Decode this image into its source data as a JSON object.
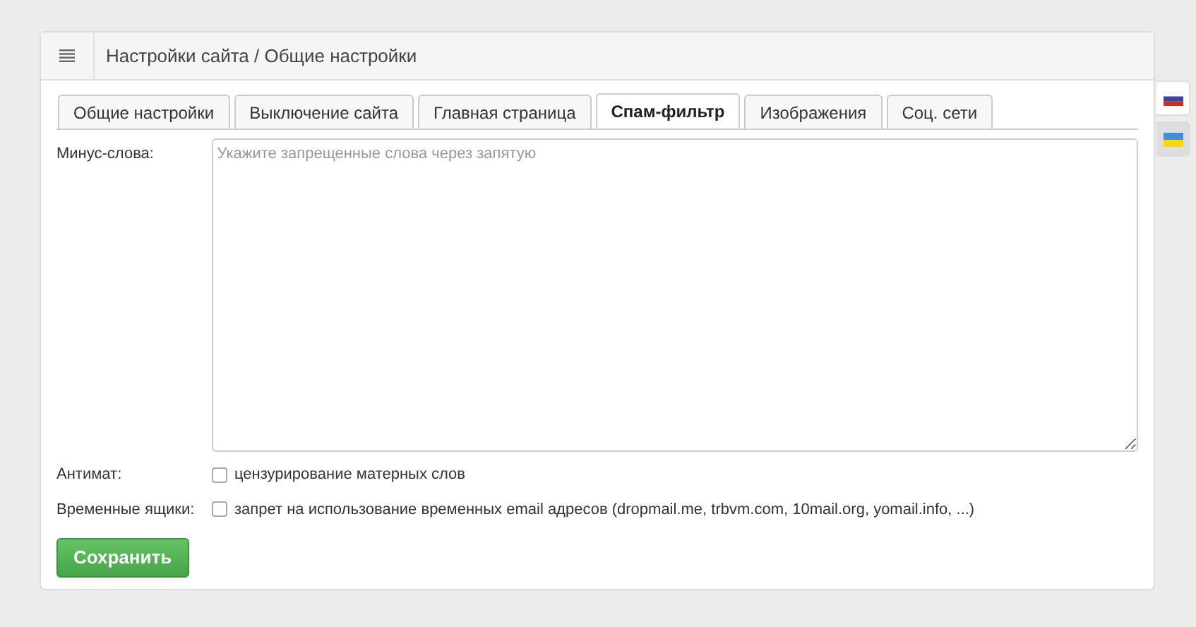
{
  "header": {
    "title": "Настройки сайта / Общие настройки"
  },
  "tabs": [
    {
      "label": "Общие настройки",
      "selected": false
    },
    {
      "label": "Выключение сайта",
      "selected": false
    },
    {
      "label": "Главная страница",
      "selected": false
    },
    {
      "label": "Спам-фильтр",
      "selected": true
    },
    {
      "label": "Изображения",
      "selected": false
    },
    {
      "label": "Соц. сети",
      "selected": false
    }
  ],
  "stop_words": {
    "label": "Минус-слова:",
    "placeholder": "Укажите запрещенные слова через запятую"
  },
  "options": [
    {
      "label": "Антимат:",
      "text": "цензурирование матерных слов",
      "checked": false
    },
    {
      "label": "Временные ящики:",
      "text": "запрет на использование временных email адресов (dropmail.me, trbvm.com, 10mail.org, yomail.info, ...)",
      "checked": false
    }
  ],
  "save_button": "Сохранить",
  "languages": [
    {
      "kind": "ru",
      "selected": true
    },
    {
      "kind": "ua",
      "selected": false
    }
  ]
}
